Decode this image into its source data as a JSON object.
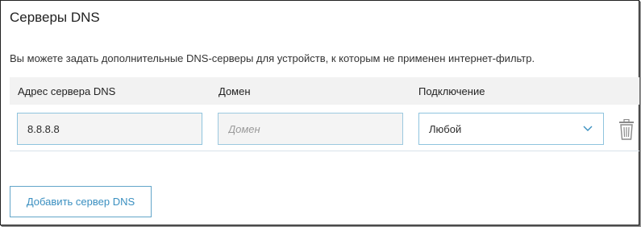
{
  "section": {
    "title": "Серверы DNS",
    "description": "Вы можете задать дополнительные DNS-серверы для устройств, к которым не применен интернет-фильтр."
  },
  "table": {
    "columns": [
      "Адрес сервера DNS",
      "Домен",
      "Подключение"
    ],
    "rows": [
      {
        "address": "8.8.8.8",
        "domain_value": "",
        "domain_placeholder": "Домен",
        "connection": "Любой"
      }
    ]
  },
  "actions": {
    "add_label": "Добавить сервер DNS"
  },
  "icons": {
    "dropdown": "chevron-down-icon",
    "delete": "trash-icon"
  },
  "colors": {
    "accent": "#3a8fc0",
    "field_border": "#8fc4de",
    "header_bg": "#f2f2f2"
  }
}
